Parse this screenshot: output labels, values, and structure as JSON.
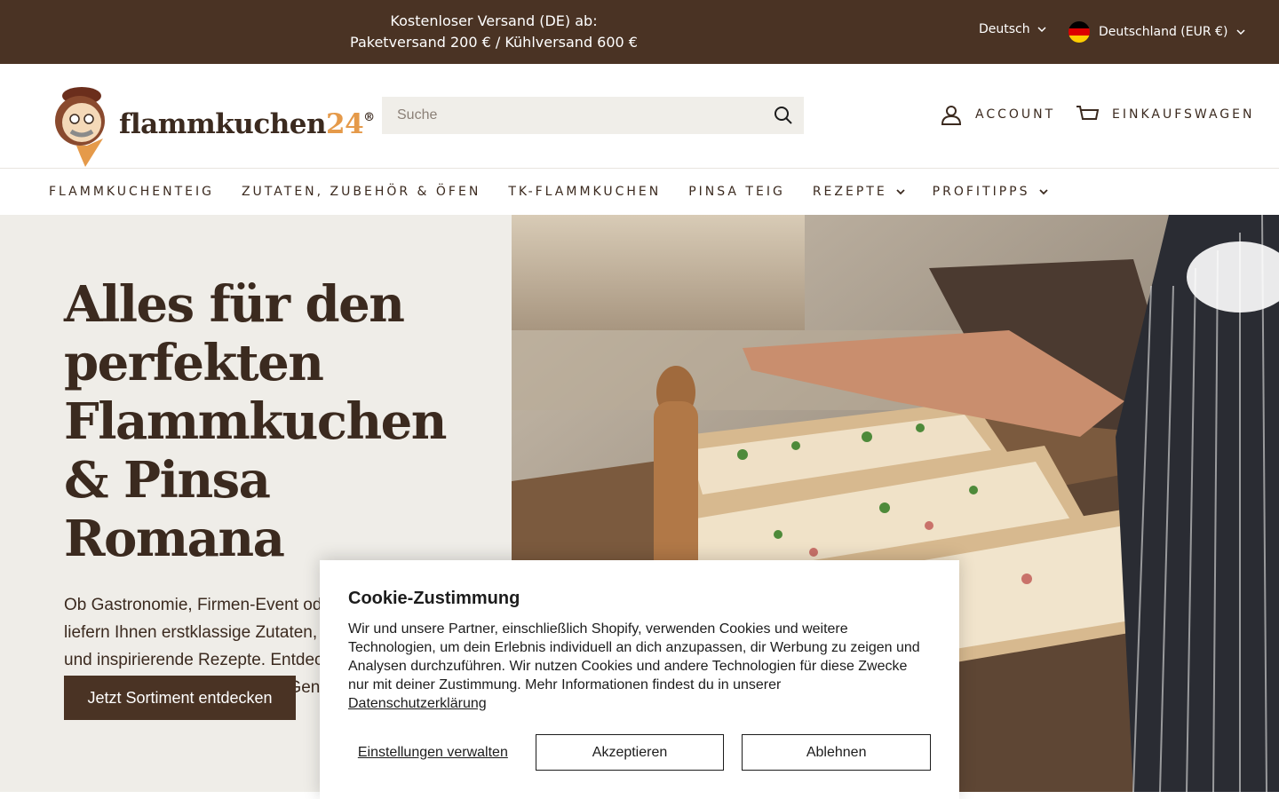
{
  "topbar": {
    "announce_line1": "Kostenloser Versand (DE) ab:",
    "announce_line2": "Paketversand 200 € / Kühlversand 600 €",
    "language": "Deutsch",
    "country": "Deutschland (EUR €)"
  },
  "header": {
    "logo_text": "flammkuchen",
    "logo_number": "24",
    "logo_reg": "®",
    "search_placeholder": "Suche",
    "account_label": "Account",
    "cart_label": "Einkaufswagen"
  },
  "nav": {
    "items": [
      {
        "label": "Flammkuchenteig"
      },
      {
        "label": "Zutaten, Zubehör & Öfen"
      },
      {
        "label": "TK-Flammkuchen"
      },
      {
        "label": "Pinsa Teig"
      },
      {
        "label": "Rezepte"
      },
      {
        "label": "Profitipps"
      }
    ]
  },
  "hero": {
    "title": "Alles für den perfekten Flammkuchen & Pinsa Romana",
    "subtitle": "Ob Gastronomie, Firmen-Event oder private Feier: Wir liefern Ihnen erstklassige Zutaten, praktisches Zubehör und inspirierende Rezepte. Entdecken Sie unsere Auswahl und bringen Sie den Genuss direkt",
    "cta": "Jetzt Sortiment entdecken"
  },
  "cookie": {
    "title": "Cookie-Zustimmung",
    "body": "Wir und unsere Partner, einschließlich Shopify, verwenden Cookies und weitere Technologien, um dein Erlebnis individuell an dich anzupassen, dir Werbung zu zeigen und Analysen durchzuführen. Wir nutzen Cookies und andere Technologien für diese Zwecke nur mit deiner Zustimmung. Mehr Informationen findest du in unserer",
    "privacy_link": "Datenschutzerklärung",
    "manage": "Einstellungen verwalten",
    "accept": "Akzeptieren",
    "decline": "Ablehnen"
  },
  "colors": {
    "brand_brown": "#4a3324",
    "accent_orange": "#e59a4a",
    "hero_bg": "#efede8"
  }
}
